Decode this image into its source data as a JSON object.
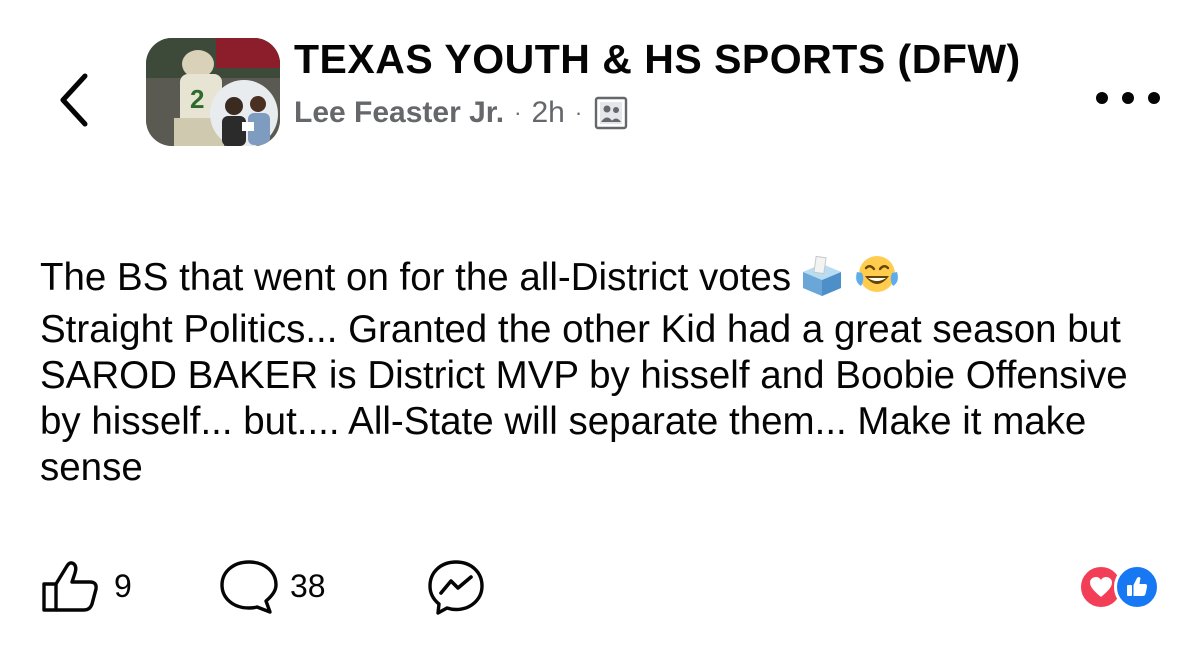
{
  "header": {
    "group_name": "TEXAS YOUTH & HS SPORTS (DFW)",
    "author": "Lee Feaster Jr.",
    "separator": "·",
    "time": "2h",
    "audience_icon": "group-members-icon"
  },
  "post": {
    "text_part1": "The BS that went on for the all-District votes",
    "text_part2": "Straight Politics... Granted the other Kid had a great season but SAROD BAKER is District MVP by hisself and Boobie Offensive by hisself... but.... All-State will separate them... Make it make sense",
    "emojis": [
      "ballot-box-icon",
      "tears-of-joy-icon"
    ]
  },
  "actions": {
    "like_count": "9",
    "comment_count": "38",
    "share_icon": "messenger-icon"
  },
  "reactions": [
    "love-reaction-icon",
    "like-reaction-icon"
  ],
  "colors": {
    "text": "#050505",
    "secondary": "#65676b",
    "love": "#f33e58",
    "like": "#1877f2"
  }
}
